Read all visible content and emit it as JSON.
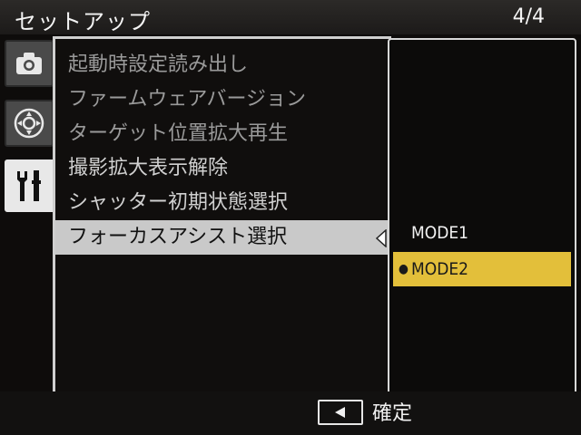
{
  "header": {
    "title": "セットアップ",
    "page_indicator": "4/4"
  },
  "tabs": [
    {
      "icon": "camera-icon",
      "active": false
    },
    {
      "icon": "dial-icon",
      "active": false
    },
    {
      "icon": "wrench-screwdriver-icon",
      "active": true
    }
  ],
  "menu": {
    "items": [
      {
        "label": "起動時設定読み出し",
        "state": "dim"
      },
      {
        "label": "ファームウェアバージョン",
        "state": "dim"
      },
      {
        "label": "ターゲット位置拡大再生",
        "state": "dim"
      },
      {
        "label": "撮影拡大表示解除",
        "state": "normal"
      },
      {
        "label": "シャッター初期状態選択",
        "state": "normal"
      },
      {
        "label": "フォーカスアシスト選択",
        "state": "selected"
      }
    ]
  },
  "submenu": {
    "options": [
      {
        "label": "MODE1",
        "current": false,
        "highlighted": false
      },
      {
        "label": "MODE2",
        "current": true,
        "highlighted": true
      }
    ]
  },
  "footer": {
    "back_icon": "left-arrow-icon",
    "confirm_label": "確定"
  },
  "colors": {
    "highlight": "#e3bf3a",
    "selection": "#c9c9c9",
    "background": "#0e0c0b"
  }
}
